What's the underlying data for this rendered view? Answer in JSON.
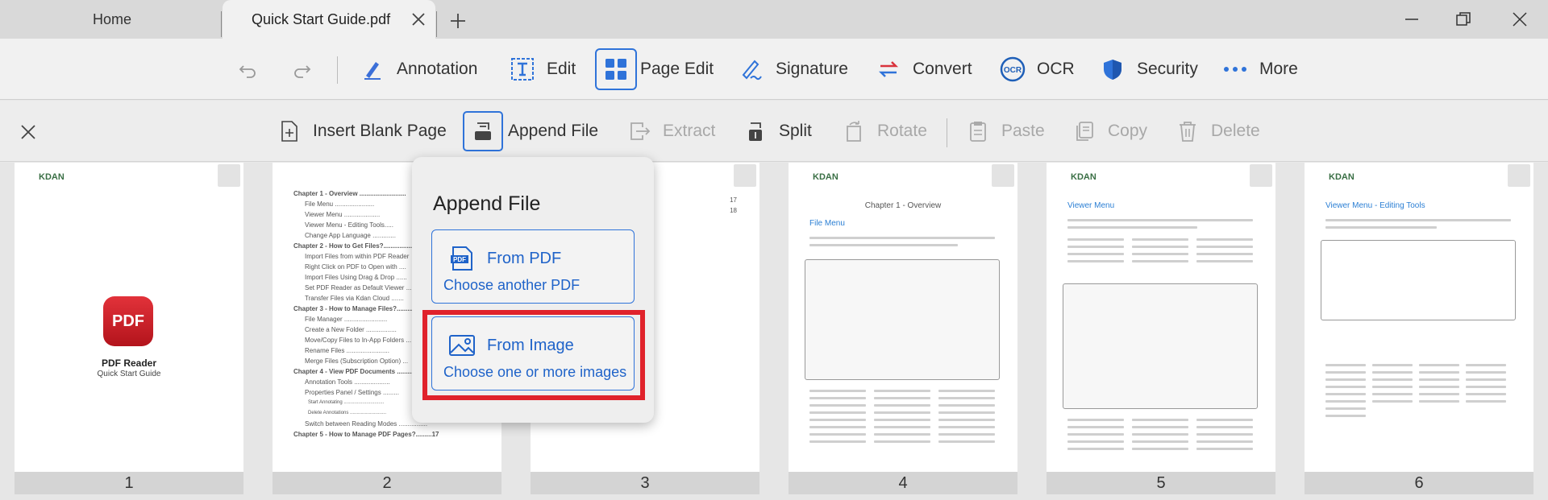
{
  "tabs": {
    "home": "Home",
    "active": "Quick Start Guide.pdf"
  },
  "toolbar": {
    "annotation": "Annotation",
    "edit": "Edit",
    "page_edit": "Page Edit",
    "signature": "Signature",
    "convert": "Convert",
    "ocr": "OCR",
    "security": "Security",
    "more": "More"
  },
  "editbar": {
    "insert_blank": "Insert Blank Page",
    "append_file": "Append File",
    "extract": "Extract",
    "split": "Split",
    "rotate": "Rotate",
    "paste": "Paste",
    "copy": "Copy",
    "delete": "Delete"
  },
  "popup": {
    "title": "Append File",
    "from_pdf": "From PDF",
    "from_pdf_sub": "Choose another PDF",
    "from_image": "From Image",
    "from_image_sub": "Choose one or more images"
  },
  "pages": [
    {
      "num": "1",
      "brand": "KDAN",
      "title": "PDF Reader",
      "subtitle": "Quick Start Guide",
      "app_icon": "PDF"
    },
    {
      "num": "2",
      "toc": [
        "Chapter 1 - Overview ..........................",
        "File Menu ......................",
        "Viewer Menu ....................",
        "Viewer Menu - Editing Tools.....",
        "Change App Language .............",
        "Chapter 2 - How to Get Files?.................",
        "Import Files from within PDF Reader",
        "Right Click on PDF to Open with ....",
        "Import Files Using Drag & Drop ......",
        "Set PDF Reader as Default Viewer ....",
        "Transfer Files via Kdan Cloud .......",
        "Chapter 3 - How to Manage Files?..............",
        "File Manager ........................",
        "Create a New Folder .................",
        "Move/Copy Files to In-App Folders ...",
        "Rename Files ........................",
        "Merge Files (Subscription Option) ...",
        "Chapter 4 - View PDF Documents ...............",
        "Annotation Tools ....................",
        "Properties Panel / Settings .........",
        "Start Annotating ..............................",
        "Delete Annotations ...........................",
        "Switch between Reading Modes ................",
        "Chapter 5 - How to Manage PDF Pages?.........17"
      ]
    },
    {
      "num": "3",
      "toc_tail": [
        "17",
        "18"
      ]
    },
    {
      "num": "4",
      "brand": "KDAN",
      "heading": "Chapter 1 - Overview",
      "section": "File Menu"
    },
    {
      "num": "5",
      "brand": "KDAN",
      "section": "Viewer Menu"
    },
    {
      "num": "6",
      "brand": "KDAN",
      "section": "Viewer Menu - Editing Tools"
    }
  ]
}
